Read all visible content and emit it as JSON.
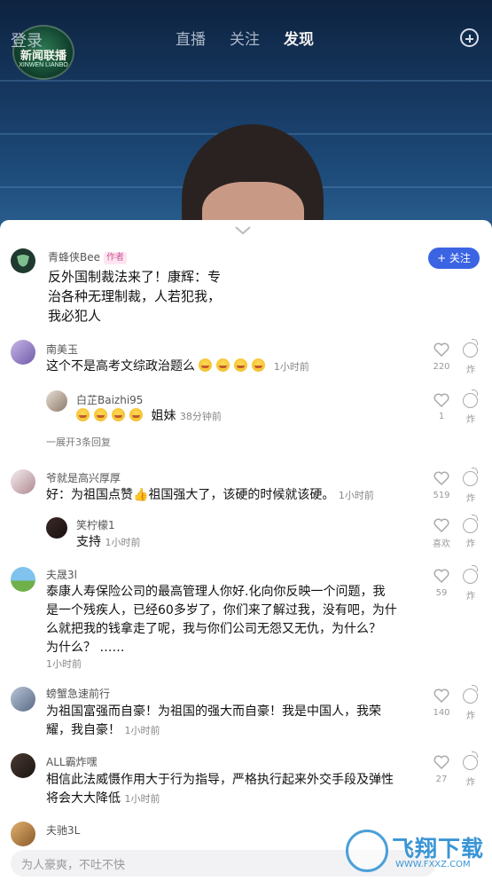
{
  "top_bar": {
    "login": "登录",
    "tabs": [
      "直播",
      "关注",
      "发现"
    ],
    "active_tab": "发现",
    "logo_main": "新闻联播",
    "logo_sub": "XINWEN LIANBO"
  },
  "post": {
    "author": "青蜂侠Bee",
    "author_tag": "作者",
    "follow_label": "+ 关注",
    "lines": [
      "反外国制裁法来了！康辉：专",
      "治各种无理制裁，人若犯我，",
      "我必犯人"
    ]
  },
  "comments": [
    {
      "name": "南美玉",
      "text": "这个不是高考文综政治题么",
      "time": "1小时前",
      "likes": "220",
      "bomb": "炸"
    },
    {
      "name": "白芷Baizhi95",
      "text": "姐妹",
      "time": "38分钟前",
      "likes": "1",
      "bomb": "炸"
    },
    {
      "name": "爷就是高兴厚厚",
      "text": "好：为祖国点赞👍祖国强大了，该硬的时候就该硬。",
      "time": "1小时前",
      "likes": "519",
      "bomb": "炸"
    },
    {
      "name": "笑柠檬1",
      "text": "支持",
      "time": "1小时前",
      "likes": "喜欢",
      "bomb": "炸"
    },
    {
      "name": "夫晟3l",
      "lines": [
        "泰康人寿保险公司的最高管理人你好.化向你反映一个问题，我",
        "是一个残疾人，已经60多岁了，你们来了解过我，没有吧，为什",
        "么就把我的钱拿走了呢，我与你们公司无怨又无仇，为什么？",
        "为什么？ ……"
      ],
      "time": "1小时前",
      "likes": "59",
      "bomb": "炸"
    },
    {
      "name": "螃蟹急速前行",
      "lines": [
        "为祖国富强而自豪！为祖国的强大而自豪！我是中国人，我荣",
        "耀，我自豪！"
      ],
      "time": "1小时前",
      "likes": "140",
      "bomb": "炸"
    },
    {
      "name": "ALL霸炸嘿",
      "lines": [
        "相信此法威慑作用大于行为指导，严格执行起来外交手段及弹性",
        "将会大大降低"
      ],
      "time": "1小时前",
      "likes": "27",
      "bomb": "炸"
    },
    {
      "name": "夫驰3L"
    }
  ],
  "expand_replies": "一展开3条回复",
  "input": {
    "placeholder": "为人豪爽，不吐不快"
  },
  "watermark": {
    "main": "飞翔下载",
    "sub": "WWW.FXXZ.COM"
  },
  "colors": {
    "accent": "#3b64e3",
    "tag": "#d0569a"
  }
}
